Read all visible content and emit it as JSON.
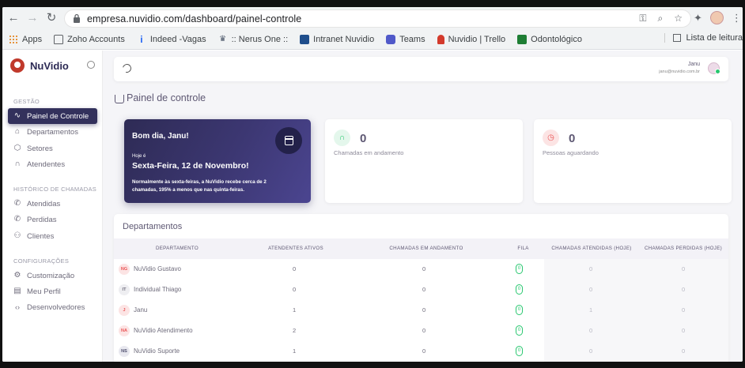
{
  "browser": {
    "url": "empresa.nuvidio.com/dashboard/painel-controle",
    "bookmarks": [
      {
        "label": "Apps",
        "color": "#e37400"
      },
      {
        "label": "Zoho Accounts",
        "color": "#5f6368"
      },
      {
        "label": "Indeed -Vagas",
        "color": "#2164f3"
      },
      {
        "label": ":: Nerus One ::",
        "color": "#4a5568"
      },
      {
        "label": "Intranet Nuvidio",
        "color": "#1f4e8c"
      },
      {
        "label": "Teams",
        "color": "#5059c9"
      },
      {
        "label": "Nuvidio | Trello",
        "color": "#d33a2c"
      },
      {
        "label": "Odontológico",
        "color": "#1e7e34"
      }
    ],
    "reading_list": "Lista de leitura"
  },
  "sidebar": {
    "brand": "NuVidio",
    "sections": [
      {
        "title": "GESTÃO",
        "items": [
          {
            "label": "Painel de Controle",
            "icon": "activity-icon",
            "active": true
          },
          {
            "label": "Departamentos",
            "icon": "home-icon"
          },
          {
            "label": "Setores",
            "icon": "box-icon"
          },
          {
            "label": "Atendentes",
            "icon": "headphones-icon"
          }
        ]
      },
      {
        "title": "HISTÓRICO DE CHAMADAS",
        "items": [
          {
            "label": "Atendidas",
            "icon": "phone-call-icon"
          },
          {
            "label": "Perdidas",
            "icon": "phone-missed-icon"
          },
          {
            "label": "Clientes",
            "icon": "users-icon"
          }
        ]
      },
      {
        "title": "CONFIGURAÇÕES",
        "items": [
          {
            "label": "Customização",
            "icon": "settings-icon"
          },
          {
            "label": "Meu Perfil",
            "icon": "profile-icon"
          },
          {
            "label": "Desenvolvedores",
            "icon": "code-icon"
          }
        ]
      }
    ]
  },
  "topbar": {
    "user_name": "Janu",
    "user_email": "janu@nuvidio.com.br"
  },
  "page": {
    "title": "Painel de controle"
  },
  "greeting": {
    "hello": "Bom dia, Janu!",
    "today_label": "Hoje é",
    "date": "Sexta-Feira, 12 de Novembro!",
    "note": "Normalmente às sexta-feiras, a NuVidio recebe cerca de 2 chamadas, 195% a menos que nas quinta-feiras."
  },
  "stats": [
    {
      "value": "0",
      "label": "Chamadas em andamento",
      "color": "#28c76f"
    },
    {
      "value": "0",
      "label": "Pessoas aguardando",
      "color": "#ea5455"
    }
  ],
  "departments": {
    "title": "Departamentos",
    "columns": [
      "DEPARTAMENTO",
      "ATENDENTES ATIVOS",
      "CHAMADAS EM ANDAMENTO",
      "FILA",
      "CHAMADAS ATENDIDAS (HOJE)",
      "CHAMADAS PERDIDAS (HOJE)"
    ],
    "rows": [
      {
        "initials": "NG",
        "name": "NuVidio Gustavo",
        "ativos": "0",
        "andamento": "0",
        "fila": "0",
        "atendidas": "0",
        "perdidas": "0",
        "bg": "#fce4e4",
        "fg": "#ea5455"
      },
      {
        "initials": "IT",
        "name": "Individual Thiago",
        "ativos": "0",
        "andamento": "0",
        "fila": "0",
        "atendidas": "0",
        "perdidas": "0",
        "bg": "#eeeef1",
        "fg": "#6e6b7b"
      },
      {
        "initials": "J",
        "name": "Janu",
        "ativos": "1",
        "andamento": "0",
        "fila": "0",
        "atendidas": "1",
        "perdidas": "0",
        "bg": "#fce4e4",
        "fg": "#ea5455"
      },
      {
        "initials": "NA",
        "name": "NuVidio Atendimento",
        "ativos": "2",
        "andamento": "0",
        "fila": "0",
        "atendidas": "0",
        "perdidas": "0",
        "bg": "#fce4e4",
        "fg": "#ea5455"
      },
      {
        "initials": "NS",
        "name": "NuVidio Suporte",
        "ativos": "1",
        "andamento": "0",
        "fila": "0",
        "atendidas": "0",
        "perdidas": "0",
        "bg": "#e8e8ef",
        "fg": "#4b4b6b"
      }
    ]
  }
}
